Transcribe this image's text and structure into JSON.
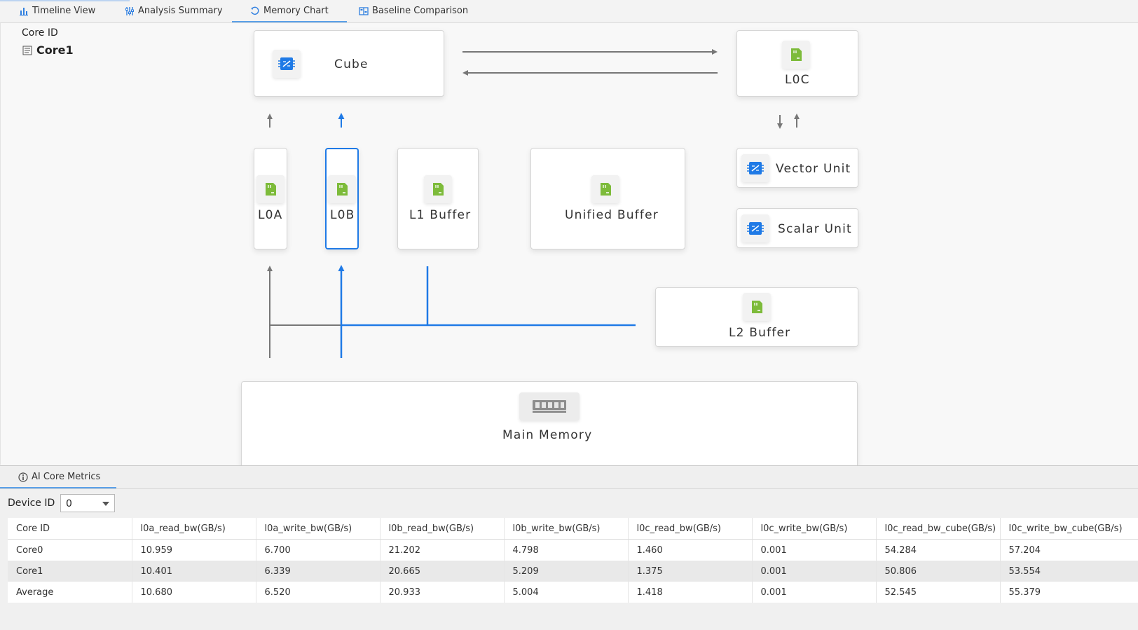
{
  "tabs": [
    {
      "label": "Timeline View"
    },
    {
      "label": "Analysis Summary"
    },
    {
      "label": "Memory Chart"
    },
    {
      "label": "Baseline Comparison"
    }
  ],
  "left_panel": {
    "core_id_label": "Core ID",
    "selected_core": "Core1"
  },
  "diagram": {
    "cube": "Cube",
    "l0c": "L0C",
    "l0a": "L0A",
    "l0b": "L0B",
    "l1_buffer": "L1 Buffer",
    "unified_buffer": "Unified Buffer",
    "vector_unit": "Vector Unit",
    "scalar_unit": "Scalar Unit",
    "l2_buffer": "L2 Buffer",
    "main_memory": "Main Memory",
    "selected_block": "L0B"
  },
  "bottom_panel": {
    "tab_label": "AI Core Metrics",
    "device_label": "Device ID",
    "device_value": "0",
    "columns": [
      "Core ID",
      "l0a_read_bw(GB/s)",
      "l0a_write_bw(GB/s)",
      "l0b_read_bw(GB/s)",
      "l0b_write_bw(GB/s)",
      "l0c_read_bw(GB/s)",
      "l0c_write_bw(GB/s)",
      "l0c_read_bw_cube(GB/s)",
      "l0c_write_bw_cube(GB/s)"
    ],
    "rows": [
      [
        "Core0",
        "10.959",
        "6.700",
        "21.202",
        "4.798",
        "1.460",
        "0.001",
        "54.284",
        "57.204"
      ],
      [
        "Core1",
        "10.401",
        "6.339",
        "20.665",
        "5.209",
        "1.375",
        "0.001",
        "50.806",
        "53.554"
      ],
      [
        "Average",
        "10.680",
        "6.520",
        "20.933",
        "5.004",
        "1.418",
        "0.001",
        "52.545",
        "55.379"
      ]
    ]
  },
  "colors": {
    "accent": "#1f7ae6",
    "memory_icon": "#7dbb3a",
    "line_gray": "#777777"
  },
  "icons": {
    "timeline": "bar-chart-icon",
    "summary": "sliders-icon",
    "memory": "refresh-chart-icon",
    "baseline": "compare-icon",
    "core": "list-icon",
    "memory_block": "memory-card-icon",
    "compute_unit": "chip-icon",
    "main_memory": "ram-stick-icon",
    "metrics": "info-circle-icon"
  }
}
